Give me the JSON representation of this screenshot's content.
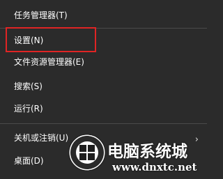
{
  "menu": {
    "items": [
      {
        "label": "任务管理器(T)"
      },
      {
        "label": "设置(N)"
      },
      {
        "label": "文件资源管理器(E)"
      },
      {
        "label": "搜索(S)"
      },
      {
        "label": "运行(R)"
      },
      {
        "label": "关机或注销(U)"
      },
      {
        "label": "桌面(D)"
      }
    ],
    "submenu_arrow": "›"
  },
  "watermark": {
    "title": "电脑系统城",
    "url": "www.dnxtc.net"
  },
  "colors": {
    "background": "#2b2b2b",
    "highlight_border": "#e02424",
    "text": "#ffffff",
    "separator": "#4a4a4a"
  }
}
